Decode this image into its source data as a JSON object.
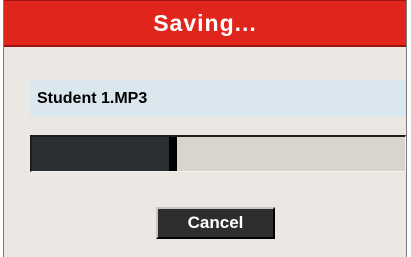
{
  "dialog": {
    "title": "Saving...",
    "filename": "Student 1.MP3",
    "progress": 0.39,
    "cancel_label": "Cancel"
  },
  "colors": {
    "titlebar": "#e0251c",
    "dialog_bg": "#ebe8e3",
    "filename_bg": "#dbe7ee",
    "progress_fill": "#2b2f32",
    "progress_track": "#d9d4cc",
    "button_bg": "#2e2e2e"
  }
}
